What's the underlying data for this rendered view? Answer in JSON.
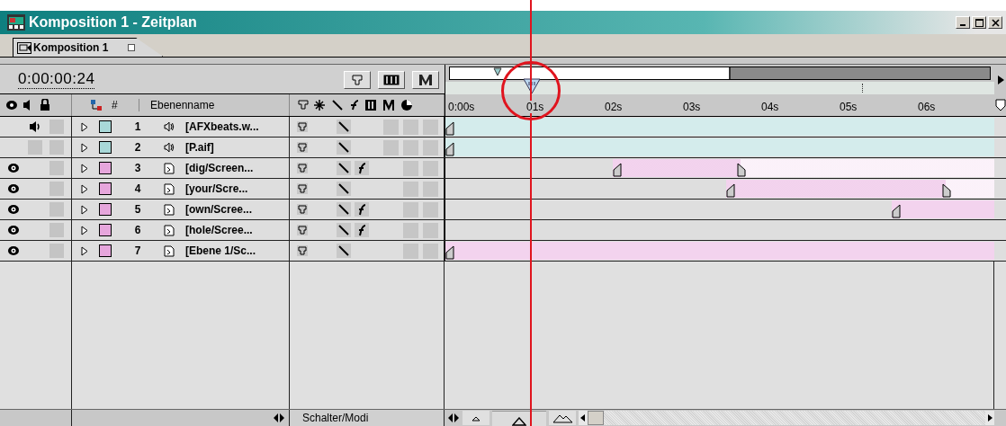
{
  "window": {
    "title": "Komposition 1 - Zeitplan"
  },
  "tabs": [
    {
      "label": "Komposition 1",
      "selected": true
    }
  ],
  "timecode": "0:00:00:24",
  "columns": {
    "number": "#",
    "name": "Ebenenname"
  },
  "ruler": {
    "ticks": [
      "0:00s",
      "01s",
      "02s",
      "03s",
      "04s",
      "05s",
      "06s"
    ]
  },
  "layers": [
    {
      "kind": "audio",
      "on": true,
      "color": "#a8d8d8",
      "number": "1",
      "name": "[AFXbeats.w...",
      "effect": false
    },
    {
      "kind": "audio",
      "on": false,
      "color": "#a8d8d8",
      "number": "2",
      "name": "[P.aif]",
      "effect": false
    },
    {
      "kind": "footage",
      "on": true,
      "color": "#e6a6dc",
      "number": "3",
      "name": "[dig/Screen...",
      "effect": true
    },
    {
      "kind": "footage",
      "on": true,
      "color": "#e6a6dc",
      "number": "4",
      "name": "[your/Scre...",
      "effect": false
    },
    {
      "kind": "footage",
      "on": true,
      "color": "#e6a6dc",
      "number": "5",
      "name": "[own/Scree...",
      "effect": true
    },
    {
      "kind": "footage",
      "on": true,
      "color": "#e6a6dc",
      "number": "6",
      "name": "[hole/Scree...",
      "effect": true
    },
    {
      "kind": "footage",
      "on": true,
      "color": "#e6a6dc",
      "number": "7",
      "name": "[Ebene 1/Sc...",
      "effect": false
    }
  ],
  "bottom": {
    "mode_button": "Schalter/Modi",
    "zoom": {
      "level": 0.5
    }
  }
}
